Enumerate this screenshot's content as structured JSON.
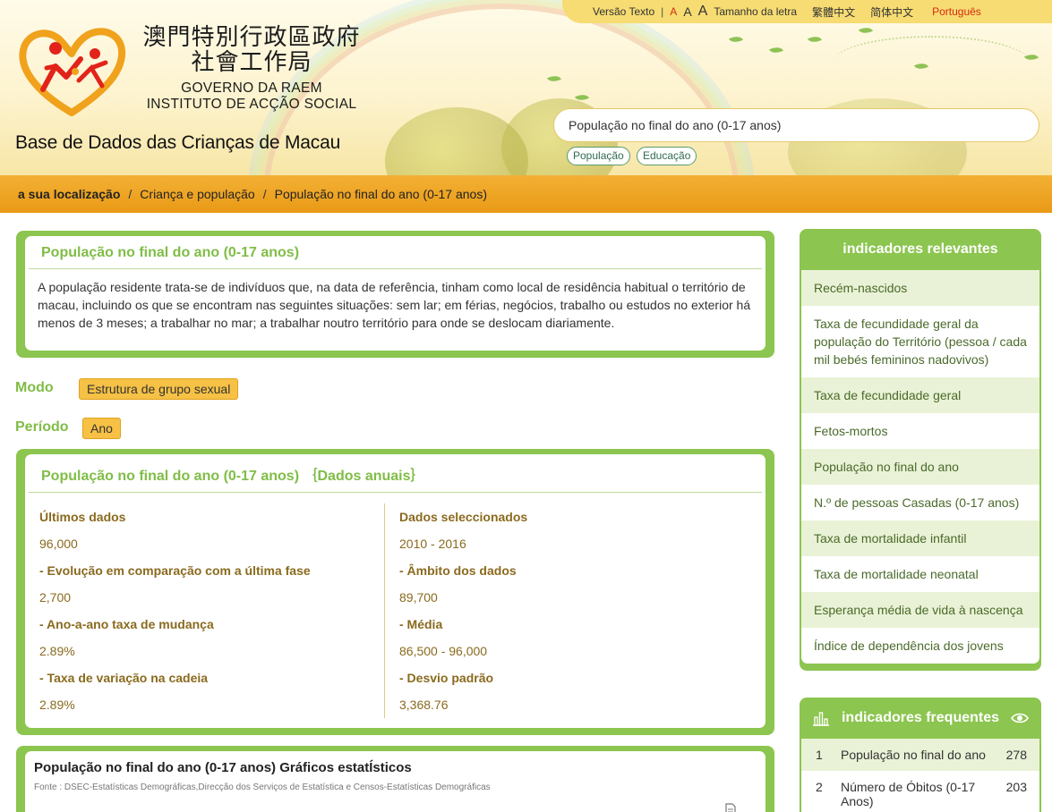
{
  "topbar": {
    "text_version": "Versão Texto",
    "separator": "|",
    "font_small": "A",
    "font_medium": "A",
    "font_large": "A",
    "font_size_label": "Tamanho da letra",
    "lang_traditional": "繁體中文",
    "lang_simplified": "简体中文",
    "lang_portuguese": "Português"
  },
  "org": {
    "name_zh_line1": "澳門特別行政區政府",
    "name_zh_line2": "社會工作局",
    "name_pt_line1": "GOVERNO DA RAEM",
    "name_pt_line2": "INSTITUTO DE ACÇÃO SOCIAL",
    "site_title": "Base de Dados das Crianças de Macau"
  },
  "search": {
    "value": "População no final do ano (0-17 anos)",
    "tags": [
      "População",
      "Educação"
    ]
  },
  "breadcrumb": {
    "label": "a sua localização",
    "sep": "/",
    "level1": "Criança e população",
    "level2": "População no final do ano (0-17 anos)"
  },
  "definition": {
    "title": "População no final do ano (0-17 anos)",
    "text": "A população residente trata-se de indivíduos que, na data de referência, tinham como local de residência habitual o território de macau, incluindo os que se encontram nas seguintes situações: sem lar; em férias, negócios, trabalho ou estudos no exterior há menos de 3 meses; a trabalhar no mar; a trabalhar noutro território para onde se deslocam diariamente."
  },
  "filters": {
    "mode_label": "Modo",
    "mode_value": "Estrutura de grupo sexual",
    "period_label": "Período",
    "period_value": "Ano"
  },
  "stats": {
    "title": "População no final do ano (0-17 anos)",
    "subtitle": "｛Dados anuais｝",
    "left": [
      {
        "label": "Últimos dados",
        "value": "96,000"
      },
      {
        "label": "- Evolução em comparação com a última fase",
        "value": "2,700"
      },
      {
        "label": "- Ano-a-ano taxa de mudança",
        "value": "2.89%"
      },
      {
        "label": "- Taxa de variação na cadeia",
        "value": "2.89%"
      }
    ],
    "right": [
      {
        "label": "Dados seleccionados",
        "value": "2010 - 2016"
      },
      {
        "label": "- Âmbito dos dados",
        "value": "89,700"
      },
      {
        "label": "- Média",
        "value": "86,500 - 96,000"
      },
      {
        "label": "- Desvio padrão",
        "value": "3,368.76"
      }
    ]
  },
  "chart_panel": {
    "title": "População no final do ano (0-17 anos) Gráficos estatÍsticos",
    "source": "Fonte : DSEC-Estatísticas Demográficas,Direcção dos Serviços de Estatística e Censos-Estatísticas Demográficas"
  },
  "related": {
    "heading": "indicadores relevantes",
    "items": [
      "Recém-nascidos",
      "Taxa de fecundidade geral da população do Território (pessoa / cada mil bebés femininos nadovivos)",
      "Taxa de fecundidade geral",
      "Fetos-mortos",
      "População no final do ano",
      "N.º de pessoas Casadas (0-17 anos)",
      "Taxa de mortalidade infantil",
      "Taxa de mortalidade neonatal",
      "Esperança média de vida à nascença",
      "Índice de dependência dos jovens"
    ]
  },
  "frequent": {
    "heading": "indicadores frequentes",
    "rows": [
      {
        "rank": "1",
        "name": "População no final do ano",
        "count": "278"
      },
      {
        "rank": "2",
        "name": "Número de Óbitos (0-17 Anos)",
        "count": "203"
      }
    ]
  },
  "colors": {
    "green": "#8cc54f",
    "orange": "#e99a16",
    "chip": "#f6c145",
    "accent_red": "#d62b0e"
  }
}
